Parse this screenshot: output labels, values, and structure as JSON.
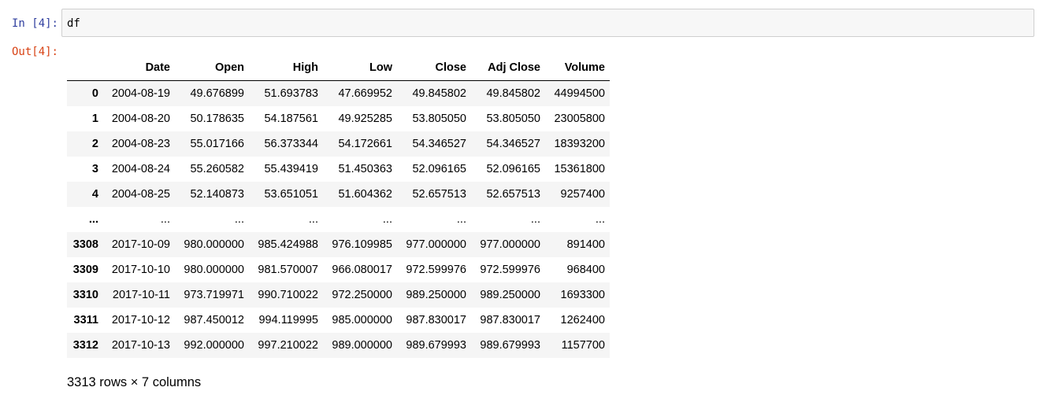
{
  "cell": {
    "in_prompt": "In [4]:",
    "out_prompt": "Out[4]:",
    "code": "df"
  },
  "table": {
    "columns": [
      "",
      "Date",
      "Open",
      "High",
      "Low",
      "Close",
      "Adj Close",
      "Volume"
    ],
    "rows": [
      [
        "0",
        "2004-08-19",
        "49.676899",
        "51.693783",
        "47.669952",
        "49.845802",
        "49.845802",
        "44994500"
      ],
      [
        "1",
        "2004-08-20",
        "50.178635",
        "54.187561",
        "49.925285",
        "53.805050",
        "53.805050",
        "23005800"
      ],
      [
        "2",
        "2004-08-23",
        "55.017166",
        "56.373344",
        "54.172661",
        "54.346527",
        "54.346527",
        "18393200"
      ],
      [
        "3",
        "2004-08-24",
        "55.260582",
        "55.439419",
        "51.450363",
        "52.096165",
        "52.096165",
        "15361800"
      ],
      [
        "4",
        "2004-08-25",
        "52.140873",
        "53.651051",
        "51.604362",
        "52.657513",
        "52.657513",
        "9257400"
      ],
      [
        "...",
        "...",
        "...",
        "...",
        "...",
        "...",
        "...",
        "..."
      ],
      [
        "3308",
        "2017-10-09",
        "980.000000",
        "985.424988",
        "976.109985",
        "977.000000",
        "977.000000",
        "891400"
      ],
      [
        "3309",
        "2017-10-10",
        "980.000000",
        "981.570007",
        "966.080017",
        "972.599976",
        "972.599976",
        "968400"
      ],
      [
        "3310",
        "2017-10-11",
        "973.719971",
        "990.710022",
        "972.250000",
        "989.250000",
        "989.250000",
        "1693300"
      ],
      [
        "3311",
        "2017-10-12",
        "987.450012",
        "994.119995",
        "985.000000",
        "987.830017",
        "987.830017",
        "1262400"
      ],
      [
        "3312",
        "2017-10-13",
        "992.000000",
        "997.210022",
        "989.000000",
        "989.679993",
        "989.679993",
        "1157700"
      ]
    ],
    "shape_note": "3313 rows × 7 columns"
  },
  "colors": {
    "in_prompt": "#303f9f",
    "out_prompt": "#d84315",
    "input_background": "#f7f7f7",
    "input_border": "#cfcfcf",
    "row_stripe": "#f5f5f5"
  }
}
